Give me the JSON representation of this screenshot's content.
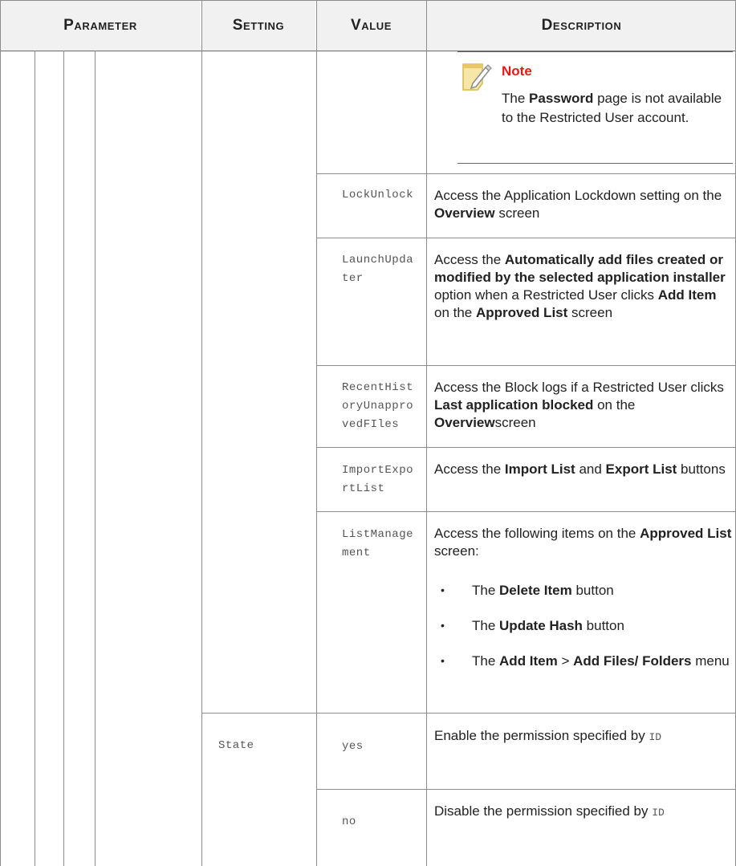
{
  "headers": {
    "parameter": "Parameter",
    "setting": "Setting",
    "value": "Value",
    "description": "Description"
  },
  "note": {
    "title": "Note",
    "text_pre": "The ",
    "text_bold": "Password",
    "text_post": " page is not available to the Restricted User account."
  },
  "rows": [
    {
      "value": "LockUnlock",
      "d1": "Access the Application Lockdown setting on the ",
      "d2": "Overview",
      "d3": " screen"
    },
    {
      "value_l1": "LaunchUpda",
      "value_l2": "ter",
      "d1": "Access the ",
      "d2": "Automatically add files created or modified by the selected application installer",
      "d3": " option when a Restricted User clicks ",
      "d4": "Add Item",
      "d5": " on the ",
      "d6": "Approved List",
      "d7": " screen"
    },
    {
      "value_l1": "RecentHist",
      "value_l2": "oryUnappro",
      "value_l3": "vedFIles",
      "d1": "Access the Block logs if a Restricted User clicks ",
      "d2": "Last application blocked",
      "d3": " on the ",
      "d4": "Overview",
      "d5": "screen"
    },
    {
      "value_l1": "ImportExpo",
      "value_l2": "rtList",
      "d1": "Access the ",
      "d2": "Import List",
      "d3": " and ",
      "d4": "Export List",
      "d5": " buttons"
    },
    {
      "value_l1": "ListManage",
      "value_l2": "ment",
      "d1": "Access the following items on the ",
      "d2": "Approved List",
      "d3": " screen:",
      "bullets": [
        {
          "a": "The ",
          "b": "Delete Item",
          "c": " button"
        },
        {
          "a": "The ",
          "b": "Update Hash",
          "c": " button"
        },
        {
          "a": "The ",
          "b": "Add Item",
          "c": " > ",
          "d": "Add Files/ Folders",
          "e": " menu"
        }
      ],
      "bullet_glyph": "•"
    }
  ],
  "state": {
    "setting": "State",
    "yes": {
      "value": "yes",
      "d1": "Enable the permission specified by ",
      "code": "ID"
    },
    "no": {
      "value": "no",
      "d1": "Disable the permission specified by ",
      "code": "ID"
    }
  }
}
